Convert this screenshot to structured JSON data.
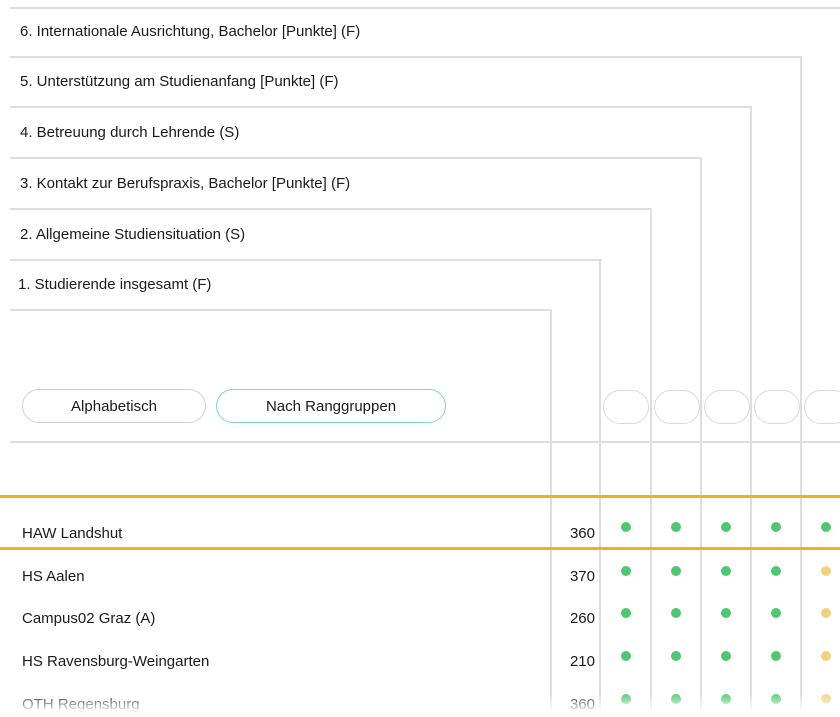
{
  "criteria": [
    "6. Internationale Ausrichtung, Bachelor [Punkte] (F)",
    "5. Unterstützung am Studienanfang [Punkte] (F)",
    "4. Betreuung durch Lehrende (S)",
    "3. Kontakt zur Berufspraxis, Bachelor [Punkte] (F)",
    "2. Allgemeine Studiensituation (S)",
    "1. Studierende insgesamt (F)"
  ],
  "sort": {
    "alphabetical_label": "Alphabetisch",
    "rank_groups_label": "Nach Ranggruppen",
    "active": "rank_groups"
  },
  "colors": {
    "green": "#4dc870",
    "yellow": "#f0d27a",
    "highlight": "#f2b01e",
    "active_border": "#7fd9b5"
  },
  "rows": [
    {
      "name": "HAW Landshut",
      "students": "360",
      "dots": [
        "green",
        "green",
        "green",
        "green",
        "green"
      ],
      "highlighted": true
    },
    {
      "name": "HS Aalen",
      "students": "370",
      "dots": [
        "green",
        "green",
        "green",
        "green",
        "yellow"
      ]
    },
    {
      "name": "Campus02 Graz (A)",
      "students": "260",
      "dots": [
        "green",
        "green",
        "green",
        "green",
        "yellow"
      ]
    },
    {
      "name": "HS Ravensburg-Weingarten",
      "students": "210",
      "dots": [
        "green",
        "green",
        "green",
        "green",
        "yellow"
      ]
    },
    {
      "name": "OTH Regensburg",
      "students": "360",
      "dots": [
        "green",
        "green",
        "green",
        "green",
        "yellow"
      ]
    }
  ]
}
